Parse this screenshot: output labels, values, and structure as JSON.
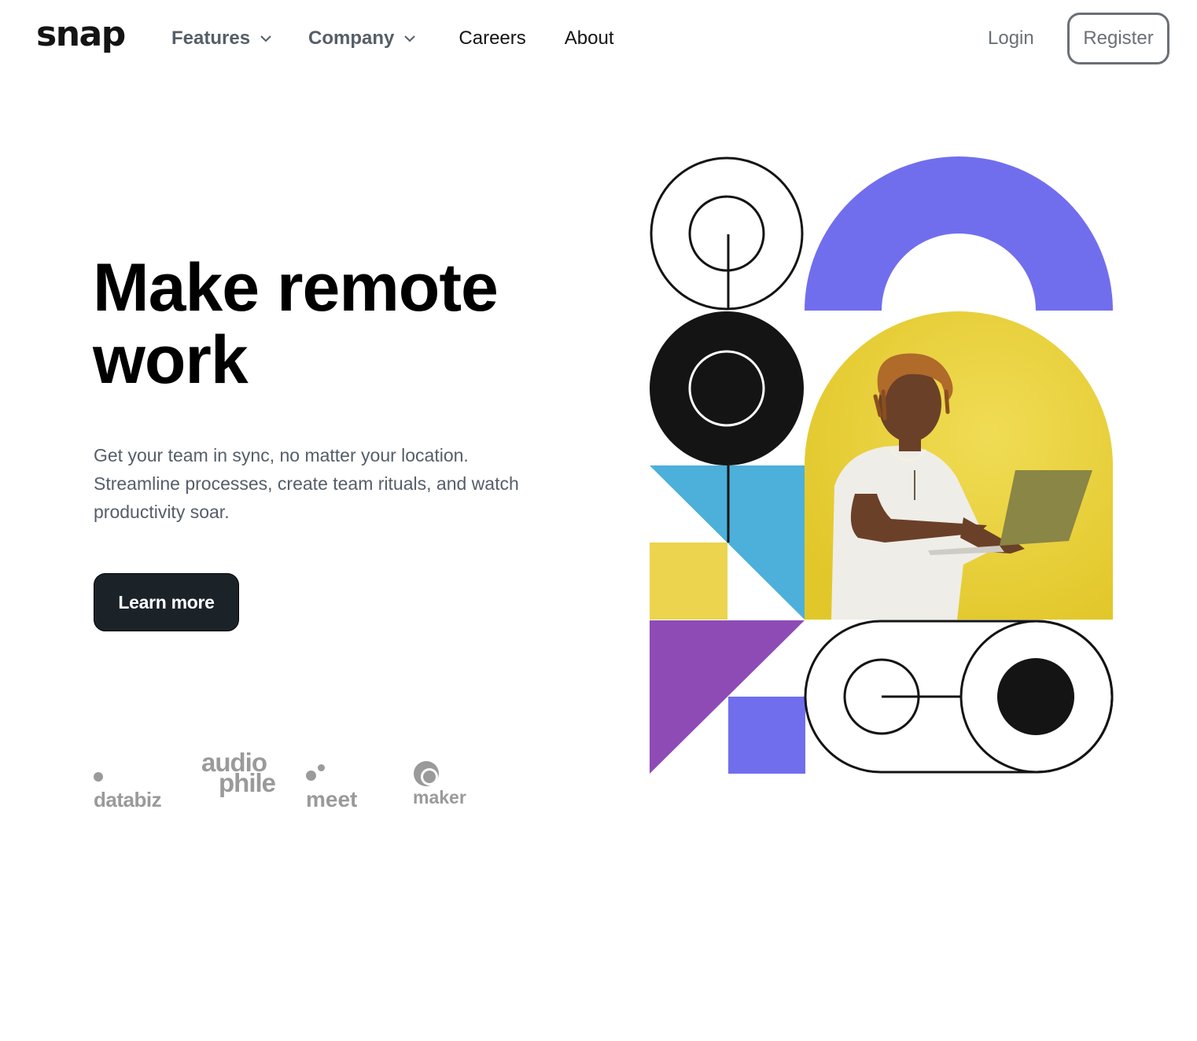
{
  "header": {
    "logo": "snap",
    "nav": [
      {
        "label": "Features",
        "dropdown": true
      },
      {
        "label": "Company",
        "dropdown": true
      },
      {
        "label": "Careers",
        "dropdown": false
      },
      {
        "label": "About",
        "dropdown": false
      }
    ],
    "login_label": "Login",
    "register_label": "Register"
  },
  "hero": {
    "title": "Make remote work",
    "subtitle": "Get your team in sync, no matter your location. Streamline processes, create team rituals, and watch productivity soar.",
    "cta_label": "Learn more"
  },
  "clients": {
    "databiz": "databiz",
    "audiophile_line1": "audio",
    "audiophile_line2": "phile",
    "meet": "meet",
    "maker": "maker"
  },
  "colors": {
    "purple": "#716eee",
    "yellow": "#ecd44f",
    "blue": "#4cb0da",
    "violet": "#8e4bb5",
    "dark": "#141414",
    "button_bg": "#1b2329",
    "muted_text": "#555e68",
    "logo_gray": "#9a9a9a"
  },
  "icons": {
    "dropdown": "chevron-down-icon"
  }
}
